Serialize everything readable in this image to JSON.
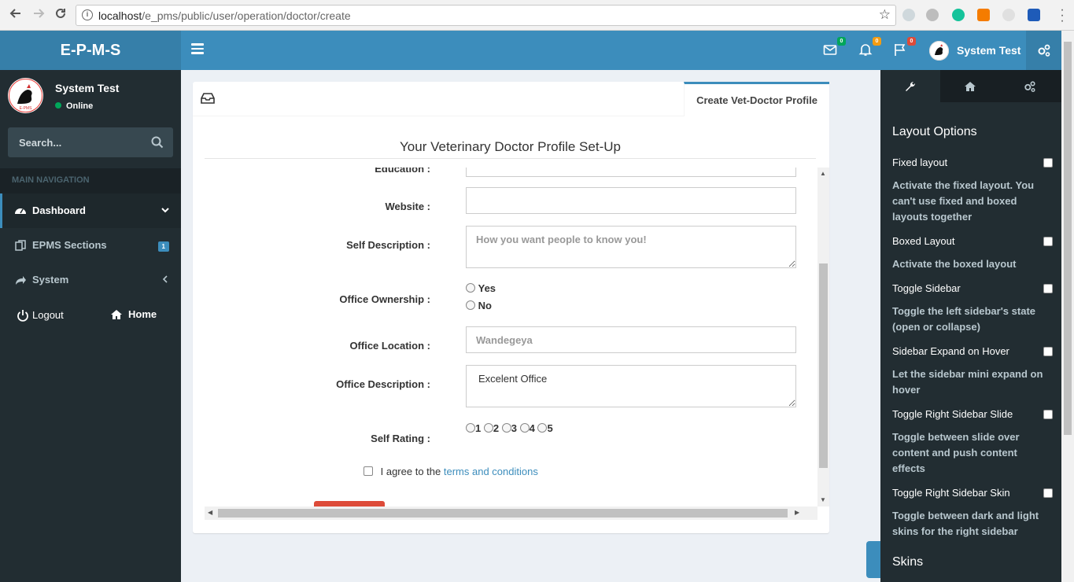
{
  "browser": {
    "url_host": "localhost",
    "url_path": "/e_pms/public/user/operation/doctor/create"
  },
  "header": {
    "logo": "E-P-M-S",
    "badges": {
      "messages": "0",
      "notifications": "0",
      "tasks": "0"
    },
    "user_name": "System Test"
  },
  "sidebar": {
    "user_name": "System Test",
    "status": "Online",
    "search_placeholder": "Search...",
    "nav_header": "MAIN NAVIGATION",
    "items": [
      {
        "label": "Dashboard"
      },
      {
        "label": "EPMS Sections",
        "badge": "1"
      },
      {
        "label": "System"
      }
    ],
    "logout": "Logout",
    "home": "Home"
  },
  "main": {
    "tab_label": "Create Vet-Doctor Profile",
    "form_title": "Your Veterinary Doctor Profile Set-Up",
    "fields": {
      "education_label": "Education :",
      "website_label": "Website :",
      "website_value": "",
      "self_desc_label": "Self Description :",
      "self_desc_placeholder": "How you want people to know you!",
      "ownership_label": "Office Ownership :",
      "ownership_options": [
        "Yes",
        "No"
      ],
      "location_label": "Office Location :",
      "location_placeholder": "Wandegeya",
      "office_desc_label": "Office Description :",
      "office_desc_value": "Excelent Office",
      "rating_label": "Self Rating :",
      "rating_options": [
        "1",
        "2",
        "3",
        "4",
        "5"
      ],
      "agree_text": "I agree to the",
      "terms_link": "terms and conditions"
    }
  },
  "control_sidebar": {
    "heading": "Layout Options",
    "options": [
      {
        "title": "Fixed layout",
        "desc": "Activate the fixed layout. You can't use fixed and boxed layouts together"
      },
      {
        "title": "Boxed Layout",
        "desc": "Activate the boxed layout"
      },
      {
        "title": "Toggle Sidebar",
        "desc": "Toggle the left sidebar's state (open or collapse)"
      },
      {
        "title": "Sidebar Expand on Hover",
        "desc": "Let the sidebar mini expand on hover"
      },
      {
        "title": "Toggle Right Sidebar Slide",
        "desc": "Toggle between slide over content and push content effects"
      },
      {
        "title": "Toggle Right Sidebar Skin",
        "desc": "Toggle between dark and light skins for the right sidebar"
      }
    ],
    "skins_heading": "Skins"
  },
  "colors": {
    "header": "#3c8dbc",
    "logo_bg": "#367fa9",
    "sidebar": "#222d32",
    "badge_green": "#00a65a",
    "badge_orange": "#f39c12",
    "badge_red": "#dd4b39"
  }
}
